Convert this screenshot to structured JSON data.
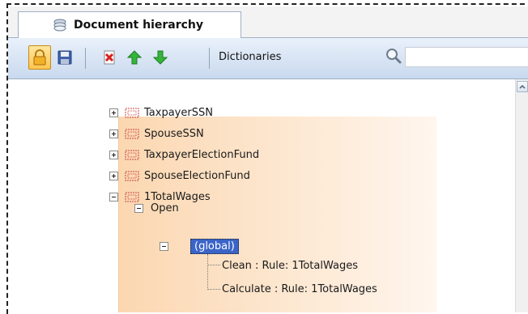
{
  "tab": {
    "title": "Document hierarchy",
    "icon": "layers-icon"
  },
  "toolbar": {
    "buttons": [
      {
        "name": "lock-icon",
        "active": true
      },
      {
        "name": "save-icon"
      },
      {
        "name": "delete-icon"
      },
      {
        "name": "move-up-icon"
      },
      {
        "name": "move-down-icon"
      }
    ],
    "dictionaries_label": "Dictionaries",
    "search": {
      "icon": "search-icon",
      "value": "",
      "placeholder": ""
    }
  },
  "tree": {
    "fields": [
      {
        "label": "TaxpayerSSN",
        "expanded": false
      },
      {
        "label": "SpouseSSN",
        "expanded": false
      },
      {
        "label": "TaxpayerElectionFund",
        "expanded": false
      },
      {
        "label": "SpouseElectionFund",
        "expanded": false
      },
      {
        "label": "1TotalWages",
        "expanded": true
      }
    ],
    "event": {
      "label": "Open",
      "expanded": true
    },
    "scope": {
      "label": "(global)",
      "expanded": true,
      "selected": true
    },
    "rules": [
      {
        "label": "Clean : Rule: 1TotalWages"
      },
      {
        "label": "Calculate : Rule: 1TotalWages"
      }
    ]
  },
  "colors": {
    "accent_selection": "#3a64c8",
    "active_button": "#ffc54f",
    "event_panel": "#fbd7b1"
  }
}
